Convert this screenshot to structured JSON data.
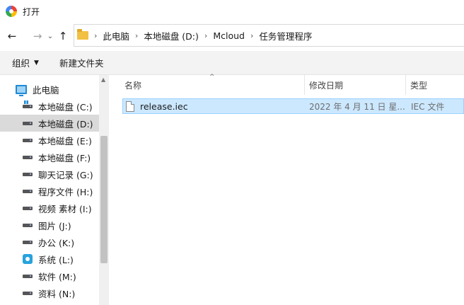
{
  "window": {
    "title": "打开",
    "app_icon": "color-wheel-icon"
  },
  "nav": {
    "back_icon": "←",
    "forward_icon": "→",
    "recent_icon": "⌄",
    "up_icon": "↑",
    "breadcrumb": [
      "此电脑",
      "本地磁盘 (D:)",
      "Mcloud",
      "任务管理程序"
    ],
    "separator": "›"
  },
  "toolbar": {
    "organize_label": "组织",
    "organize_caret": "▼",
    "new_folder_label": "新建文件夹"
  },
  "sidebar": {
    "root_label": "此电脑",
    "items": [
      {
        "label": "本地磁盘 (C:)",
        "icon": "system-drive-icon"
      },
      {
        "label": "本地磁盘 (D:)",
        "icon": "drive-icon",
        "selected": true
      },
      {
        "label": "本地磁盘 (E:)",
        "icon": "drive-icon"
      },
      {
        "label": "本地磁盘 (F:)",
        "icon": "drive-icon"
      },
      {
        "label": "聊天记录 (G:)",
        "icon": "drive-icon"
      },
      {
        "label": "程序文件 (H:)",
        "icon": "drive-icon"
      },
      {
        "label": "视频 素材 (I:)",
        "icon": "drive-icon"
      },
      {
        "label": "图片 (J:)",
        "icon": "drive-icon"
      },
      {
        "label": "办公 (K:)",
        "icon": "drive-icon"
      },
      {
        "label": "系统 (L:)",
        "icon": "disc-drive-icon"
      },
      {
        "label": "软件 (M:)",
        "icon": "drive-icon"
      },
      {
        "label": "资料 (N:)",
        "icon": "drive-icon"
      }
    ]
  },
  "columns": {
    "name": "名称",
    "date": "修改日期",
    "type": "类型",
    "sort_indicator": "^"
  },
  "files": [
    {
      "name": "release.iec",
      "date": "2022 年 4 月 11 日 星...",
      "type": "IEC 文件"
    }
  ],
  "colors": {
    "selection_bg": "#cce8ff",
    "selection_border": "#99d1ff",
    "toolbar_bg": "#f3f3f3",
    "sidebar_selected": "#dadada"
  }
}
